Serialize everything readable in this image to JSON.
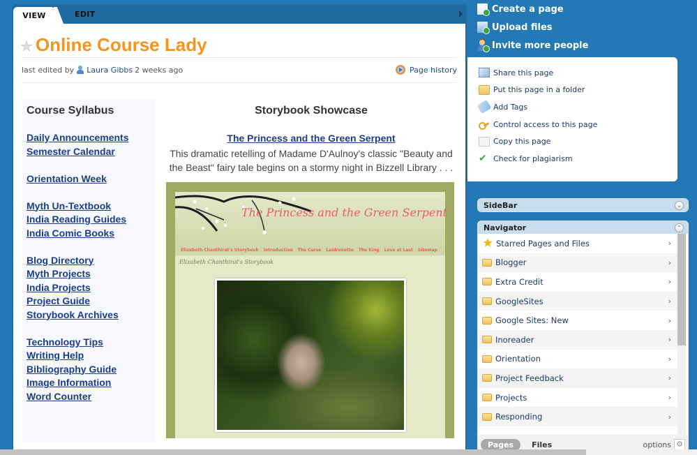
{
  "tabs": {
    "view": "VIEW",
    "edit": "EDIT"
  },
  "page": {
    "title": "Online Course Lady",
    "last_edited_prefix": "last edited by",
    "editor": "Laura Gibbs",
    "edited_when": "2 weeks ago",
    "history_label": "Page history"
  },
  "syllabus": {
    "title": "Course Syllabus",
    "groups": [
      [
        "Daily Announcements",
        "Semester Calendar"
      ],
      [
        "Orientation Week"
      ],
      [
        "Myth Un-Textbook",
        "India Reading Guides",
        "India Comic Books"
      ],
      [
        "Blog Directory",
        "Myth Projects",
        "India Projects",
        "Project Guide",
        "Storybook Archives"
      ],
      [
        "Technology Tips",
        "Writing Help",
        "Bibliography Guide",
        "Image Information",
        "Word Counter"
      ]
    ]
  },
  "showcase": {
    "title": "Storybook Showcase",
    "story_title": "The Princess and the Green Serpent",
    "story_description": "This dramatic retelling of Madame D'Aulnoy's classic \"Beauty and the Beast\" fairy tale begins on a stormy night in Bizzell Library . . .",
    "image": {
      "banner_title": "The Princess and the Green Serpent",
      "nav": [
        "Elizabeth Chanthirat's Storybook",
        "Introduction",
        "The Curse",
        "Laidronette",
        "The King",
        "Love at Last",
        "Sitemap"
      ],
      "subtitle": "Elizabeth Chanthirat's Storybook"
    }
  },
  "top_actions": [
    {
      "label": "Create a page",
      "icon": "create-page-icon"
    },
    {
      "label": "Upload files",
      "icon": "upload-files-icon"
    },
    {
      "label": "Invite more people",
      "icon": "invite-people-icon"
    }
  ],
  "page_actions": [
    {
      "label": "Share this page",
      "icon": "share-mail-icon"
    },
    {
      "label": "Put this page in a folder",
      "icon": "folder-icon"
    },
    {
      "label": "Add Tags",
      "icon": "tag-icon"
    },
    {
      "label": "Control access to this page",
      "icon": "key-icon"
    },
    {
      "label": "Copy this page",
      "icon": "copy-icon"
    },
    {
      "label": "Check for plagiarism",
      "icon": "checkmark-icon"
    }
  ],
  "sidebar_widget": {
    "title": "SideBar"
  },
  "navigator": {
    "title": "Navigator",
    "items": [
      {
        "label": "Starred Pages and Files",
        "type": "starred"
      },
      {
        "label": "Blogger",
        "type": "folder"
      },
      {
        "label": "Extra Credit",
        "type": "folder"
      },
      {
        "label": "GoogleSites",
        "type": "folder"
      },
      {
        "label": "Google Sites: New",
        "type": "folder"
      },
      {
        "label": "Inoreader",
        "type": "folder"
      },
      {
        "label": "Orientation",
        "type": "folder"
      },
      {
        "label": "Project Feedback",
        "type": "folder"
      },
      {
        "label": "Projects",
        "type": "folder"
      },
      {
        "label": "Responding",
        "type": "folder"
      }
    ],
    "footer": {
      "pages": "Pages",
      "files": "Files",
      "options": "options"
    }
  },
  "colors": {
    "background": "#2378b6",
    "title_orange": "#f7941d",
    "link_blue": "#1a3e8a",
    "image_frame": "#9fa964",
    "image_title": "#f05a6a"
  }
}
